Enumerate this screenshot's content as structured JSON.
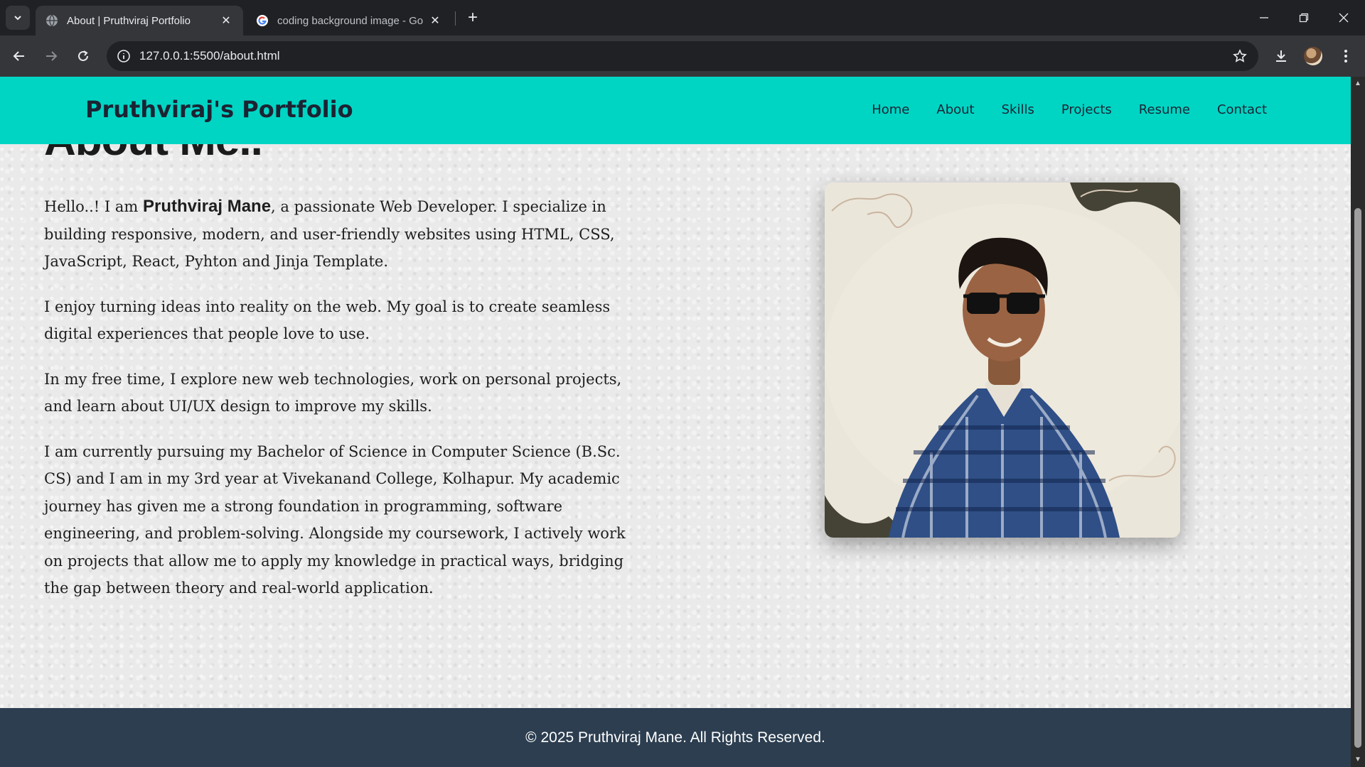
{
  "browser": {
    "tabs": [
      {
        "title": "About | Pruthviraj Portfolio",
        "active": true
      },
      {
        "title": "coding background image - Go",
        "active": false
      }
    ],
    "url": "127.0.0.1:5500/about.html",
    "icons": [
      "tab-search-icon",
      "globe-icon",
      "google-icon",
      "close-icon",
      "plus-icon",
      "minimize-icon",
      "restore-icon",
      "close-window-icon",
      "back-arrow-icon",
      "forward-arrow-icon",
      "reload-icon",
      "info-icon",
      "star-icon",
      "download-icon",
      "profile-avatar",
      "kebab-menu-icon"
    ]
  },
  "header": {
    "brand": "Pruthviraj's Portfolio",
    "nav": [
      "Home",
      "About",
      "Skills",
      "Projects",
      "Resume",
      "Contact"
    ],
    "bg_color": "#00d5c4"
  },
  "about": {
    "heading": "About Me..",
    "p1": {
      "before": "Hello..! I am ",
      "name": "Pruthviraj Mane",
      "after": ", a passionate Web Developer. I specialize in building responsive, modern, and user-friendly websites using HTML, CSS, JavaScript, React, Pyhton and Jinja Template."
    },
    "p2": "I enjoy turning ideas into reality on the web. My goal is to create seamless digital experiences that people love to use.",
    "p3": "In my free time, I explore new web technologies, work on personal projects, and learn about UI/UX design to improve my skills.",
    "p4": "I am currently pursuing my Bachelor of  Science in Computer Science (B.Sc. CS) and I am in my 3rd year at Vivekanand College, Kolhapur. My academic journey has given me a strong foundation in programming, software engineering, and problem-solving. Alongside my coursework, I actively work on projects that allow me to apply my knowledge in practical ways, bridging the gap between theory and real-world application."
  },
  "footer": {
    "text": "© 2025 Pruthviraj Mane. All Rights Reserved.",
    "bg_color": "#2c3e50"
  }
}
